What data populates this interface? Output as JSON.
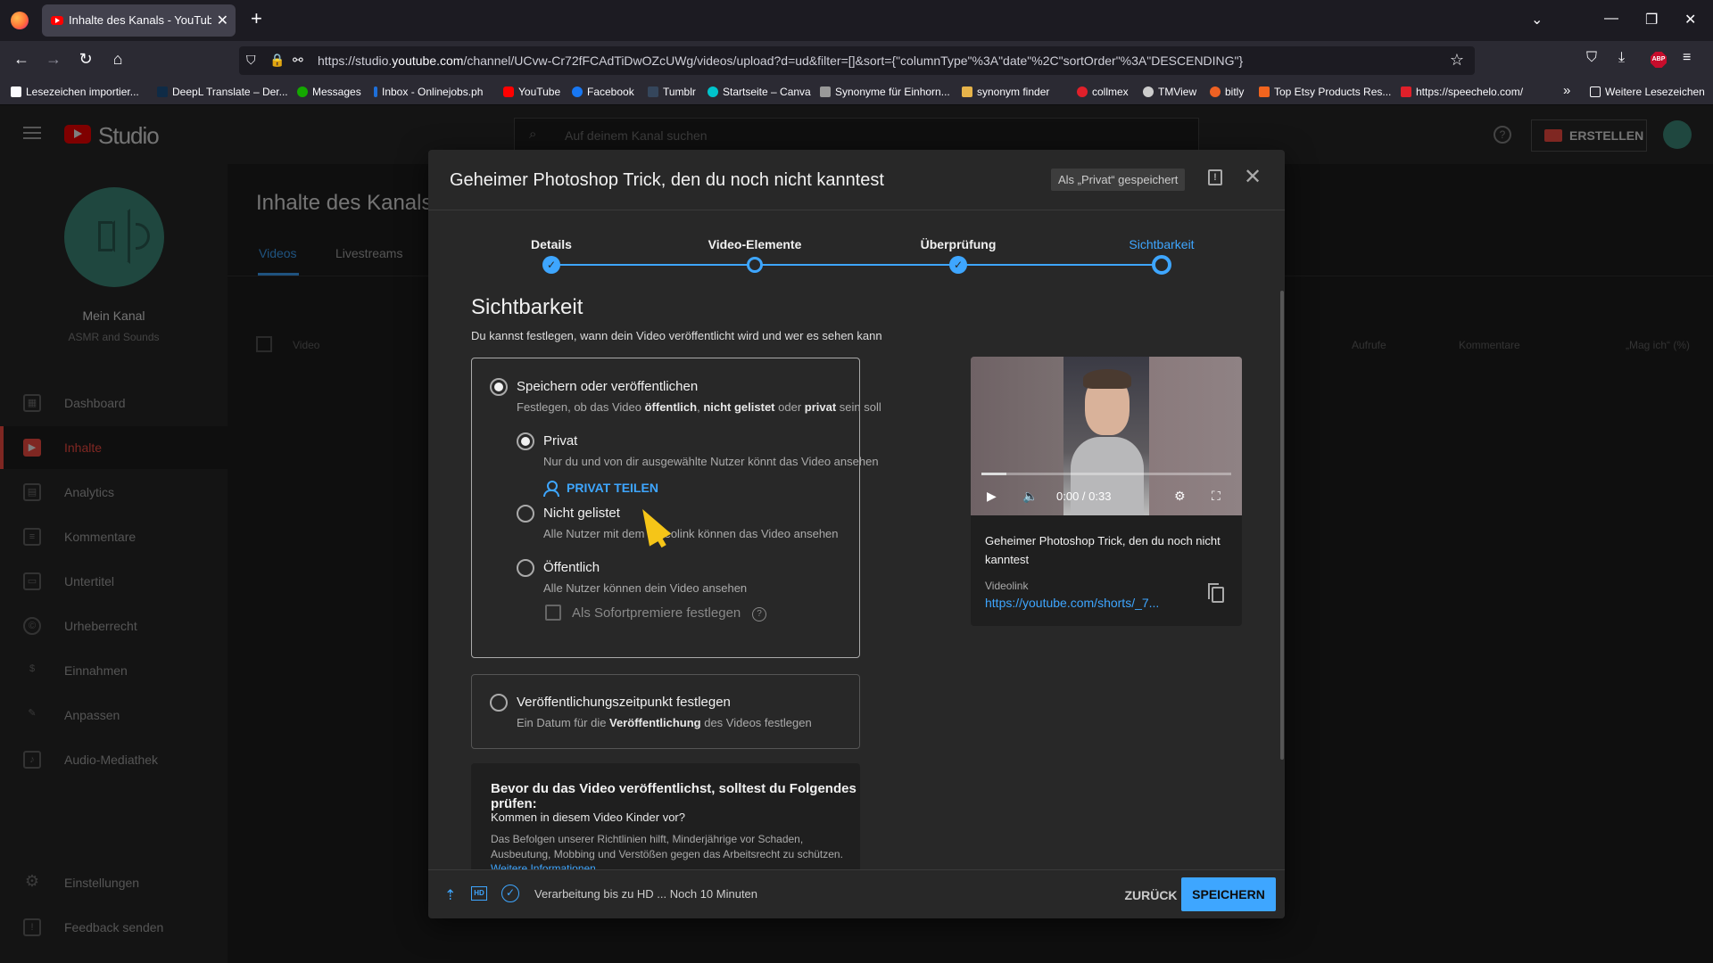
{
  "browser": {
    "tab_title": "Inhalte des Kanals - YouTube Studio",
    "tab_close": "✕",
    "new_tab": "+",
    "url_prefix": "https://studio.",
    "url_domain": "youtube.com",
    "url_rest": "/channel/UCvw-Cr72fFCAdTiDwOZcUWg/videos/upload?d=ud&filter=[]&sort={\"columnType\"%3A\"date\"%2C\"sortOrder\"%3A\"DESCENDING\"}",
    "bookmarks": [
      {
        "label": "Lesezeichen importier...",
        "color": "#fbfbfe"
      },
      {
        "label": "DeepL Translate – Der...",
        "color": "#0f2b46"
      },
      {
        "label": "Messages",
        "color": "#14a800"
      },
      {
        "label": "Inbox - Onlinejobs.ph",
        "color": "#1e6fd9"
      },
      {
        "label": "YouTube",
        "color": "#ff0000"
      },
      {
        "label": "Facebook",
        "color": "#1877f2"
      },
      {
        "label": "Tumblr",
        "color": "#35465c"
      },
      {
        "label": "Startseite – Canva",
        "color": "#00c4cc"
      },
      {
        "label": "Synonyme für Einhorn...",
        "color": "#999999"
      },
      {
        "label": "synonym finder",
        "color": "#e6b34a"
      },
      {
        "label": "collmex",
        "color": "#e0202a"
      },
      {
        "label": "TMView",
        "color": "#cccccc"
      },
      {
        "label": "bitly",
        "color": "#ee6123"
      },
      {
        "label": "Top Etsy Products Res...",
        "color": "#f1641e"
      },
      {
        "label": "https://speechelo.com/",
        "color": "#e0202a"
      }
    ],
    "bookmarks_overflow": "»",
    "other_bookmarks": "Weitere Lesezeichen",
    "abp_label": "ABP"
  },
  "studio": {
    "logo_text": "Studio",
    "search_placeholder": "Auf deinem Kanal suchen",
    "create_label": "ERSTELLEN",
    "help": "?",
    "channel_name": "Mein Kanal",
    "channel_sub": "ASMR and Sounds",
    "nav": [
      {
        "label": "Dashboard",
        "icon": "▦"
      },
      {
        "label": "Inhalte",
        "icon": "▶"
      },
      {
        "label": "Analytics",
        "icon": "▤"
      },
      {
        "label": "Kommentare",
        "icon": "≡"
      },
      {
        "label": "Untertitel",
        "icon": "▭"
      },
      {
        "label": "Urheberrecht",
        "icon": "©"
      },
      {
        "label": "Einnahmen",
        "icon": "$"
      },
      {
        "label": "Anpassen",
        "icon": "✎"
      },
      {
        "label": "Audio-Mediathek",
        "icon": "♪"
      }
    ],
    "nav_bottom": [
      {
        "label": "Einstellungen",
        "icon": "⚙"
      },
      {
        "label": "Feedback senden",
        "icon": "!"
      }
    ],
    "page_title": "Inhalte des Kanals",
    "tabs": [
      "Videos",
      "Livestreams"
    ],
    "columns": [
      "Video",
      "Aufrufe",
      "Kommentare",
      "„Mag ich“ (%)"
    ]
  },
  "dialog": {
    "title": "Geheimer Photoshop Trick, den du noch nicht kanntest",
    "saved_chip": "Als „Privat“ gespeichert",
    "feedback_icon": "!",
    "close_icon": "✕",
    "steps": [
      {
        "label": "Details",
        "state": "done"
      },
      {
        "label": "Video-Elemente",
        "state": "visited"
      },
      {
        "label": "Überprüfung",
        "state": "done"
      },
      {
        "label": "Sichtbarkeit",
        "state": "current"
      }
    ],
    "check_mark": "✓",
    "section_title": "Sichtbarkeit",
    "section_sub": "Du kannst festlegen, wann dein Video veröffentlicht wird und wer es sehen kann",
    "save_publish": {
      "label": "Speichern oder veröffentlichen",
      "desc_1": "Festlegen, ob das Video ",
      "desc_b1": "öffentlich",
      "desc_2": ", ",
      "desc_b2": "nicht gelistet",
      "desc_3": " oder ",
      "desc_b3": "privat",
      "desc_4": " sein soll"
    },
    "options": [
      {
        "label": "Privat",
        "desc": "Nur du und von dir ausgewählte Nutzer könnt das Video ansehen",
        "selected": true
      },
      {
        "label": "Nicht gelistet",
        "desc": "Alle Nutzer mit dem Videolink können das Video ansehen",
        "selected": false
      },
      {
        "label": "Öffentlich",
        "desc": "Alle Nutzer können dein Video ansehen",
        "selected": false
      }
    ],
    "share_private": "PRIVAT TEILEN",
    "premiere_label": "Als Sofortpremiere festlegen",
    "premiere_help": "?",
    "schedule": {
      "label": "Veröffentlichungszeitpunkt festlegen",
      "desc_1": "Ein Datum für die ",
      "desc_b": "Veröffentlichung",
      "desc_2": " des Videos festlegen"
    },
    "precheck": {
      "title": "Bevor du das Video veröffentlichst, solltest du Folgendes prüfen:",
      "question": "Kommen in diesem Video Kinder vor?",
      "text": "Das Befolgen unserer Richtlinien hilft, Minderjährige vor Schaden, Ausbeutung, Mobbing und Verstößen gegen das Arbeitsrecht zu schützen.",
      "link": "Weitere Informationen"
    },
    "preview": {
      "time": "0:00 / 0:33",
      "progress_fraction": 0.1,
      "title": "Geheimer Photoshop Trick, den du noch nicht kanntest",
      "link_label": "Videolink",
      "link": "https://youtube.com/shorts/_7..."
    },
    "footer": {
      "status": "Verarbeitung bis zu HD ... Noch 10 Minuten",
      "hd": "HD",
      "back": "ZURÜCK",
      "save": "SPEICHERN"
    }
  },
  "colors": {
    "accent": "#3ea6ff",
    "brand": "#ff0000",
    "active_nav": "#ff4e45",
    "cursor": "#f5c518"
  }
}
